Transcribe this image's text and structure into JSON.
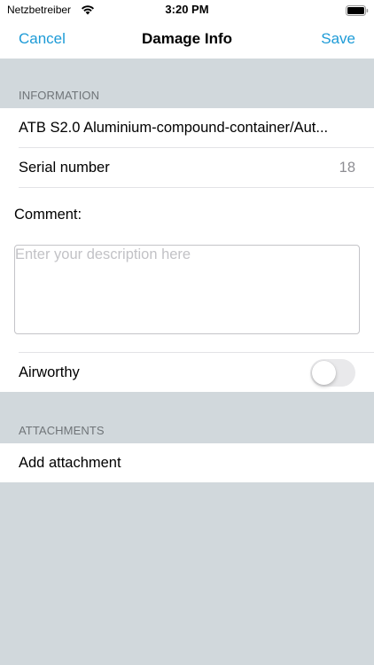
{
  "status_bar": {
    "carrier": "Netzbetreiber",
    "time": "3:20 PM",
    "wifi_icon": "wifi-icon",
    "battery_icon": "battery-icon"
  },
  "nav": {
    "cancel_label": "Cancel",
    "title": "Damage Info",
    "save_label": "Save"
  },
  "colors": {
    "accent": "#1d9bd7",
    "background": "#d1d8dc"
  },
  "information": {
    "header": "INFORMATION",
    "item_name": "ATB S2.0 Aluminium-compound-container/Aut...",
    "serial_label": "Serial number",
    "serial_value": "18",
    "comment_label": "Comment:",
    "comment_value": "",
    "comment_placeholder": "Enter your description here",
    "airworthy_label": "Airworthy",
    "airworthy_on": false
  },
  "attachments": {
    "header": "ATTACHMENTS",
    "add_label": "Add attachment"
  }
}
